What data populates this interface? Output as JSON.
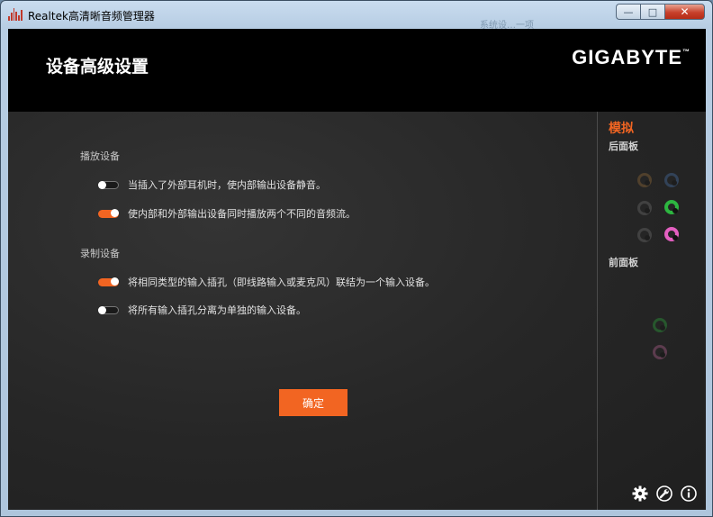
{
  "window": {
    "title": "Realtek高清晰音频管理器",
    "ghost_text": "系统设…一项",
    "buttons": {
      "minimize": "—",
      "maximize": "□",
      "close": "✕"
    }
  },
  "header": {
    "title": "设备高级设置",
    "brand": "GIGABYTE",
    "brand_tm": "™"
  },
  "playback": {
    "label": "播放设备",
    "options": [
      {
        "label": "当插入了外部耳机时，使内部输出设备静音。",
        "enabled": false
      },
      {
        "label": "使内部和外部输出设备同时播放两个不同的音频流。",
        "enabled": true
      }
    ]
  },
  "recording": {
    "label": "录制设备",
    "options": [
      {
        "label": "将相同类型的输入插孔（即线路输入或麦克风）联结为一个输入设备。",
        "enabled": true
      },
      {
        "label": "将所有输入插孔分离为单独的输入设备。",
        "enabled": false
      }
    ]
  },
  "ok_button": "确定",
  "side_panel": {
    "title": "模拟",
    "rear_label": "后面板",
    "front_label": "前面板",
    "rear_jacks": [
      {
        "color": "#a0743a",
        "state": "dim"
      },
      {
        "color": "#4c7bb8",
        "state": "dim"
      },
      {
        "color": "#777777",
        "state": "dim"
      },
      {
        "color": "#2db640",
        "state": "active"
      },
      {
        "color": "#777777",
        "state": "dim"
      },
      {
        "color": "#e35fc0",
        "state": "active"
      }
    ],
    "front_jacks": [
      {
        "color": "#2db640",
        "state": "dim"
      },
      {
        "color": "#c76a9e",
        "state": "dim"
      }
    ]
  },
  "bottom_icons": [
    "gear-icon",
    "wrench-icon",
    "info-icon"
  ],
  "colors": {
    "accent": "#f26522",
    "header_bg": "#000000",
    "panel_bg": "#262626"
  }
}
